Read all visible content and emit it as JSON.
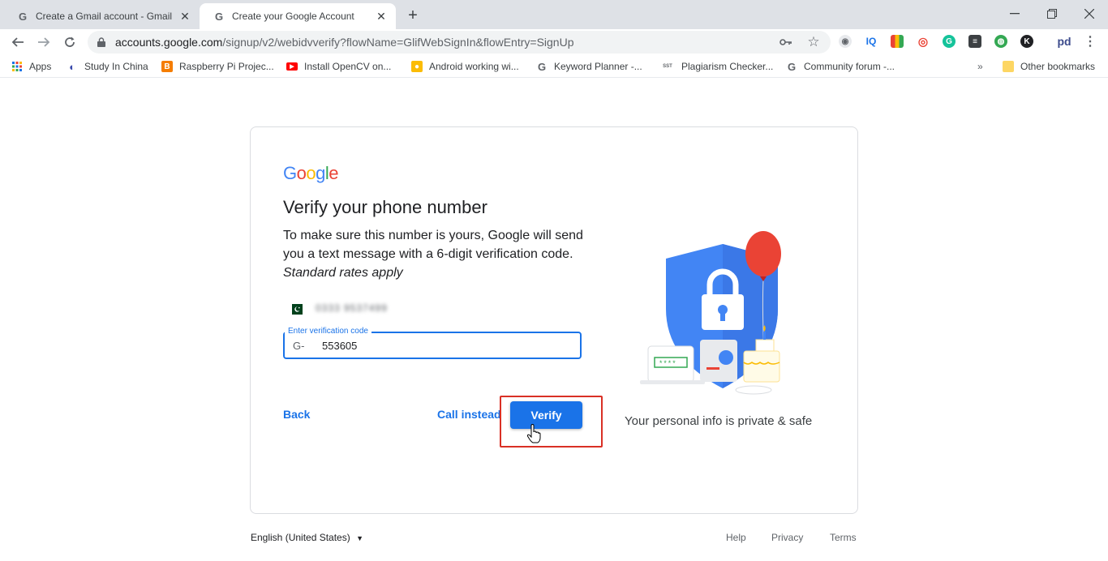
{
  "browser": {
    "tabs": [
      {
        "title": "Create a Gmail account - Gmail H",
        "icon": "google-icon"
      },
      {
        "title": "Create your Google Account",
        "icon": "google-icon"
      }
    ],
    "url_host": "accounts.google.com",
    "url_rest": "/signup/v2/webidvverify?flowName=GlifWebSignIn&flowEntry=SignUp",
    "bookmarks": [
      {
        "label": "Apps",
        "icon": "apps-grid-icon"
      },
      {
        "label": "Study In China",
        "icon": "globe-icon"
      },
      {
        "label": "Raspberry Pi Projec...",
        "icon": "blogger-icon"
      },
      {
        "label": "Install OpenCV on...",
        "icon": "youtube-icon"
      },
      {
        "label": "Android working wi...",
        "icon": "bookmark-icon"
      },
      {
        "label": "Keyword Planner -...",
        "icon": "google-icon"
      },
      {
        "label": "Plagiarism Checker...",
        "icon": "sst-icon"
      },
      {
        "label": "Community forum -...",
        "icon": "google-icon"
      }
    ],
    "more_bookmarks": "»",
    "other_bookmarks": "Other bookmarks",
    "extensions": [
      "IQ"
    ]
  },
  "card": {
    "logo_letters": [
      "G",
      "o",
      "o",
      "g",
      "l",
      "e"
    ],
    "heading": "Verify your phone number",
    "description_plain": "To make sure this number is yours, Google will send you a text message with a 6-digit verification code. ",
    "description_em": "Standard rates apply",
    "phone_masked": "0333 9537499",
    "field_label": "Enter verification code",
    "code_prefix": "G-",
    "code_value": "553605",
    "back_label": "Back",
    "call_label": "Call instead",
    "verify_label": "Verify",
    "private_text": "Your personal info is private & safe",
    "colors": {
      "accent": "#1a73e8",
      "highlight": "#d93025"
    }
  },
  "footer": {
    "language": "English (United States)",
    "links": [
      "Help",
      "Privacy",
      "Terms"
    ]
  }
}
